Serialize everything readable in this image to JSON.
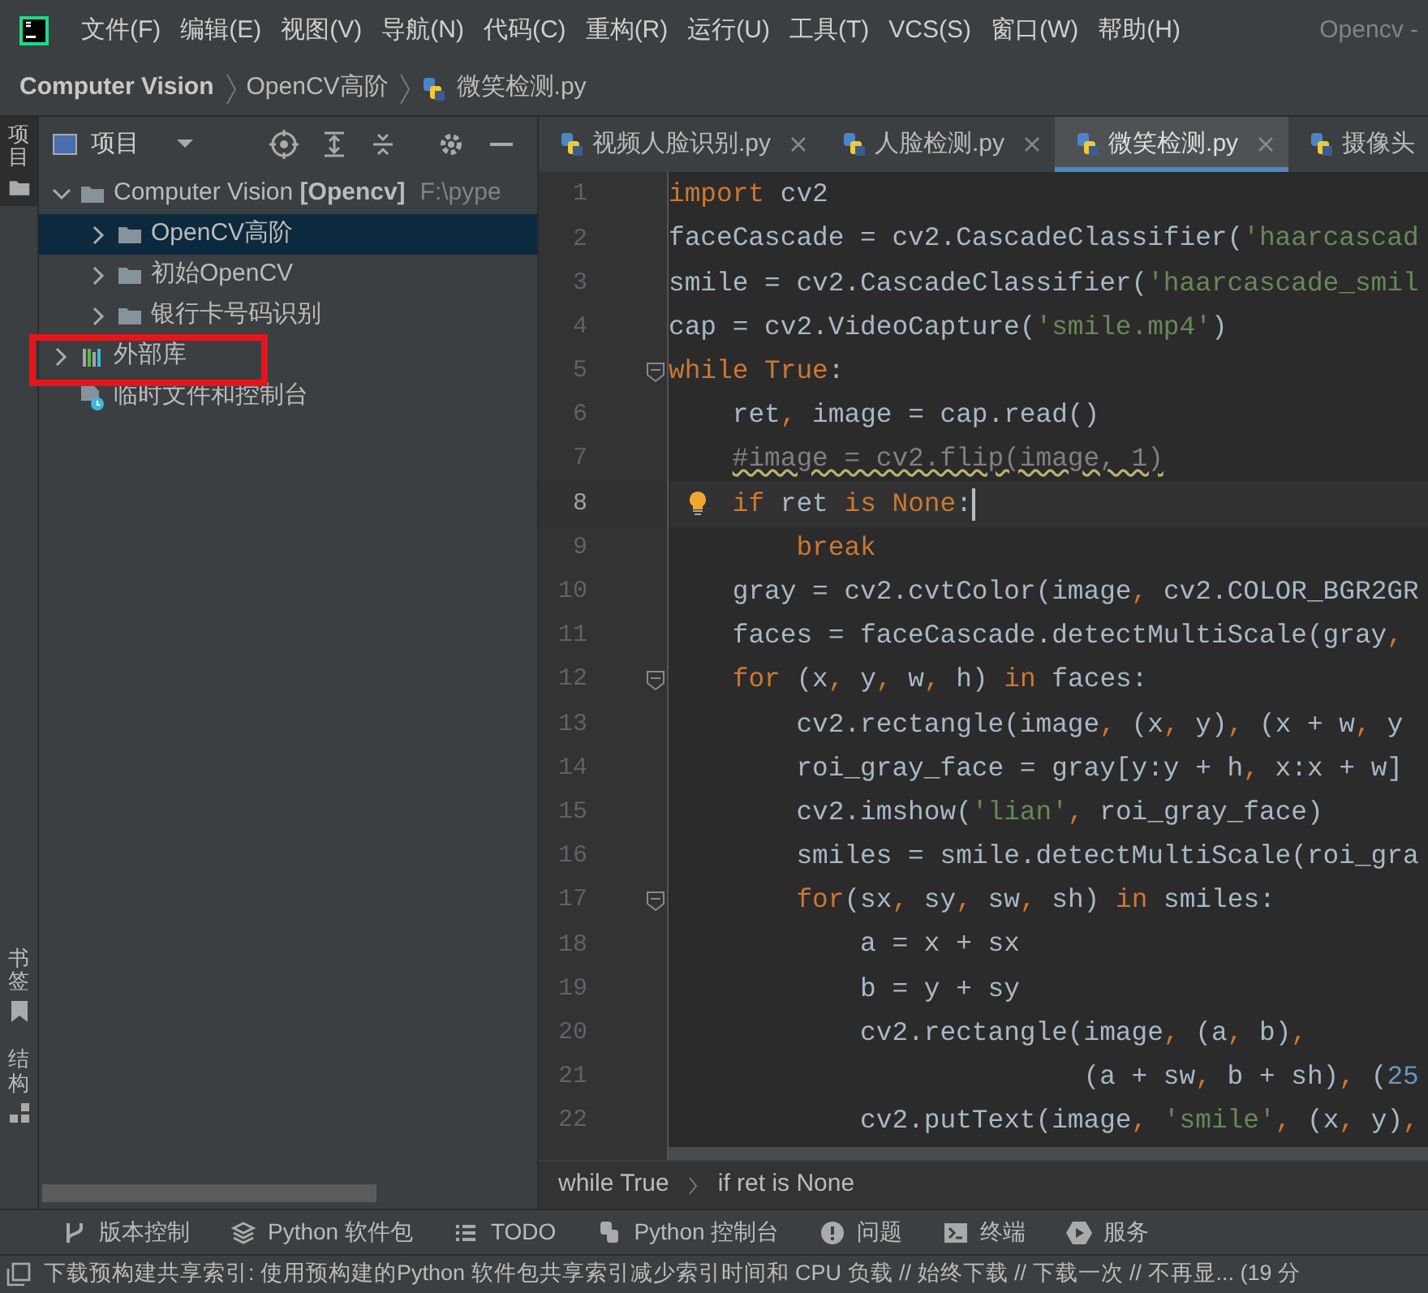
{
  "window": {
    "title": "Opencv -"
  },
  "menu": [
    "文件(F)",
    "编辑(E)",
    "视图(V)",
    "导航(N)",
    "代码(C)",
    "重构(R)",
    "运行(U)",
    "工具(T)",
    "VCS(S)",
    "窗口(W)",
    "帮助(H)"
  ],
  "breadcrumb": [
    {
      "label": "Computer Vision",
      "kind": "project"
    },
    {
      "label": "OpenCV高阶",
      "kind": "folder"
    },
    {
      "label": "微笑检测.py",
      "kind": "python"
    }
  ],
  "left_stripe": [
    {
      "label": "项目",
      "kind": "folder",
      "selected": true
    },
    {
      "label": "书签",
      "kind": "bookmark",
      "selected": false
    },
    {
      "label": "结构",
      "kind": "structure",
      "selected": false
    }
  ],
  "project_panel": {
    "title": "项目",
    "tree": [
      {
        "label": "Computer Vision **[Opencv]**",
        "path": "F:\\pype",
        "kind": "folder",
        "expanded": true,
        "selected": false,
        "children": [
          {
            "label": "OpenCV高阶",
            "kind": "folder",
            "expanded": false,
            "selected": true
          },
          {
            "label": "初始OpenCV",
            "kind": "folder",
            "expanded": false,
            "selected": false
          },
          {
            "label": "银行卡号码识别",
            "kind": "folder",
            "expanded": false,
            "selected": false
          }
        ]
      },
      {
        "label": "外部库",
        "kind": "library",
        "expanded": false,
        "selected": false,
        "highlighted": true
      },
      {
        "label": "临时文件和控制台",
        "kind": "scratch",
        "selected": false,
        "highlighted": false
      }
    ]
  },
  "tabs": [
    {
      "label": "视频人脸识别.py",
      "selected": false,
      "closable": true
    },
    {
      "label": "人脸检测.py",
      "selected": false,
      "closable": true
    },
    {
      "label": "微笑检测.py",
      "selected": true,
      "closable": true
    },
    {
      "label": "摄像头",
      "selected": false,
      "closable": false
    }
  ],
  "editor": {
    "lines": [
      {
        "n": "1",
        "current": false,
        "fold": false,
        "tokens": [
          {
            "kind": "keyword",
            "text": "import"
          },
          {
            "kind": "plain",
            "text": " cv2"
          }
        ]
      },
      {
        "n": "2",
        "current": false,
        "fold": false,
        "tokens": [
          {
            "kind": "plain",
            "text": "faceCascade = cv2.CascadeClassifier("
          },
          {
            "kind": "string",
            "text": "'haarcascad"
          }
        ]
      },
      {
        "n": "3",
        "current": false,
        "fold": false,
        "tokens": [
          {
            "kind": "plain",
            "text": "smile = cv2.CascadeClassifier("
          },
          {
            "kind": "string",
            "text": "'haarcascade_smil"
          }
        ]
      },
      {
        "n": "4",
        "current": false,
        "fold": false,
        "tokens": [
          {
            "kind": "plain",
            "text": "cap = cv2.VideoCapture("
          },
          {
            "kind": "string",
            "text": "'smile.mp4'"
          },
          {
            "kind": "plain",
            "text": ")"
          }
        ]
      },
      {
        "n": "5",
        "current": false,
        "fold": true,
        "tokens": [
          {
            "kind": "keyword",
            "text": "while True"
          },
          {
            "kind": "plain",
            "text": ":"
          }
        ]
      },
      {
        "n": "6",
        "current": false,
        "fold": false,
        "tokens": [
          {
            "kind": "plain",
            "text": "    ret"
          },
          {
            "kind": "comma",
            "text": ","
          },
          {
            "kind": "plain",
            "text": " image = cap.read()"
          }
        ]
      },
      {
        "n": "7",
        "current": false,
        "fold": false,
        "tokens": [
          {
            "kind": "comment",
            "text": "    #image = cv2.flip(image, 1)"
          }
        ]
      },
      {
        "n": "8",
        "current": true,
        "fold": false,
        "tokens": [
          {
            "kind": "keyword",
            "text": "    if"
          },
          {
            "kind": "plain",
            "text": " ret "
          },
          {
            "kind": "keyword",
            "text": "is None"
          },
          {
            "kind": "plain",
            "text": ":"
          }
        ]
      },
      {
        "n": "9",
        "current": false,
        "fold": false,
        "tokens": [
          {
            "kind": "keyword",
            "text": "        break"
          }
        ]
      },
      {
        "n": "10",
        "current": false,
        "fold": false,
        "tokens": [
          {
            "kind": "plain",
            "text": "    gray = cv2.cvtColor(image"
          },
          {
            "kind": "comma",
            "text": ","
          },
          {
            "kind": "plain",
            "text": " cv2.COLOR_BGR2GR"
          }
        ]
      },
      {
        "n": "11",
        "current": false,
        "fold": false,
        "tokens": [
          {
            "kind": "plain",
            "text": "    faces = faceCascade.detectMultiScale(gray"
          },
          {
            "kind": "comma",
            "text": ","
          }
        ]
      },
      {
        "n": "12",
        "current": false,
        "fold": true,
        "tokens": [
          {
            "kind": "keyword",
            "text": "    for"
          },
          {
            "kind": "plain",
            "text": " (x"
          },
          {
            "kind": "comma",
            "text": ","
          },
          {
            "kind": "plain",
            "text": " y"
          },
          {
            "kind": "comma",
            "text": ","
          },
          {
            "kind": "plain",
            "text": " w"
          },
          {
            "kind": "comma",
            "text": ","
          },
          {
            "kind": "plain",
            "text": " h) "
          },
          {
            "kind": "keyword",
            "text": "in"
          },
          {
            "kind": "plain",
            "text": " faces:"
          }
        ]
      },
      {
        "n": "13",
        "current": false,
        "fold": false,
        "tokens": [
          {
            "kind": "plain",
            "text": "        cv2.rectangle(image"
          },
          {
            "kind": "comma",
            "text": ","
          },
          {
            "kind": "plain",
            "text": " (x"
          },
          {
            "kind": "comma",
            "text": ","
          },
          {
            "kind": "plain",
            "text": " y)"
          },
          {
            "kind": "comma",
            "text": ","
          },
          {
            "kind": "plain",
            "text": " (x + w"
          },
          {
            "kind": "comma",
            "text": ","
          },
          {
            "kind": "plain",
            "text": " y"
          }
        ]
      },
      {
        "n": "14",
        "current": false,
        "fold": false,
        "tokens": [
          {
            "kind": "plain",
            "text": "        roi_gray_face = gray[y:y + h"
          },
          {
            "kind": "comma",
            "text": ","
          },
          {
            "kind": "plain",
            "text": " x:x + w]"
          }
        ]
      },
      {
        "n": "15",
        "current": false,
        "fold": false,
        "tokens": [
          {
            "kind": "plain",
            "text": "        cv2.imshow("
          },
          {
            "kind": "string",
            "text": "'lian'"
          },
          {
            "kind": "comma",
            "text": ","
          },
          {
            "kind": "plain",
            "text": " roi_gray_face)"
          }
        ]
      },
      {
        "n": "16",
        "current": false,
        "fold": false,
        "tokens": [
          {
            "kind": "plain",
            "text": "        smiles = smile.detectMultiScale(roi_gra"
          }
        ]
      },
      {
        "n": "17",
        "current": false,
        "fold": true,
        "tokens": [
          {
            "kind": "keyword",
            "text": "        for"
          },
          {
            "kind": "plain",
            "text": "(sx"
          },
          {
            "kind": "comma",
            "text": ","
          },
          {
            "kind": "plain",
            "text": " sy"
          },
          {
            "kind": "comma",
            "text": ","
          },
          {
            "kind": "plain",
            "text": " sw"
          },
          {
            "kind": "comma",
            "text": ","
          },
          {
            "kind": "plain",
            "text": " sh) "
          },
          {
            "kind": "keyword",
            "text": "in"
          },
          {
            "kind": "plain",
            "text": " smiles:"
          }
        ]
      },
      {
        "n": "18",
        "current": false,
        "fold": false,
        "tokens": [
          {
            "kind": "plain",
            "text": "            a = x + sx"
          }
        ]
      },
      {
        "n": "19",
        "current": false,
        "fold": false,
        "tokens": [
          {
            "kind": "plain",
            "text": "            b = y + sy"
          }
        ]
      },
      {
        "n": "20",
        "current": false,
        "fold": false,
        "tokens": [
          {
            "kind": "plain",
            "text": "            cv2.rectangle(image"
          },
          {
            "kind": "comma",
            "text": ","
          },
          {
            "kind": "plain",
            "text": " (a"
          },
          {
            "kind": "comma",
            "text": ","
          },
          {
            "kind": "plain",
            "text": " b)"
          },
          {
            "kind": "comma",
            "text": ","
          }
        ]
      },
      {
        "n": "21",
        "current": false,
        "fold": false,
        "tokens": [
          {
            "kind": "plain",
            "text": "                          (a + sw"
          },
          {
            "kind": "comma",
            "text": ","
          },
          {
            "kind": "plain",
            "text": " b + sh)"
          },
          {
            "kind": "comma",
            "text": ","
          },
          {
            "kind": "plain",
            "text": " ("
          },
          {
            "kind": "number",
            "text": "25"
          }
        ]
      },
      {
        "n": "22",
        "current": false,
        "fold": false,
        "tokens": [
          {
            "kind": "plain",
            "text": "            cv2.putText(image"
          },
          {
            "kind": "comma",
            "text": ","
          },
          {
            "kind": "string",
            "text": " 'smile'"
          },
          {
            "kind": "comma",
            "text": ","
          },
          {
            "kind": "plain",
            "text": " (x"
          },
          {
            "kind": "comma",
            "text": ","
          },
          {
            "kind": "plain",
            "text": " y)"
          },
          {
            "kind": "comma",
            "text": ","
          }
        ]
      }
    ],
    "breadcrumb": [
      "while True",
      "if ret is None"
    ]
  },
  "tool_windows": [
    {
      "label": "版本控制",
      "kind": "vcs"
    },
    {
      "label": "Python 软件包",
      "kind": "packages"
    },
    {
      "label": "TODO",
      "kind": "todo"
    },
    {
      "label": "Python 控制台",
      "kind": "python"
    },
    {
      "label": "问题",
      "kind": "problems"
    },
    {
      "label": "终端",
      "kind": "terminal"
    },
    {
      "label": "服务",
      "kind": "services"
    }
  ],
  "status_bar": {
    "message": "下载预构建共享索引: 使用预构建的Python 软件包共享索引减少索引时间和 CPU 负载 // 始终下载 // 下载一次 // 不再显... (19 分"
  }
}
